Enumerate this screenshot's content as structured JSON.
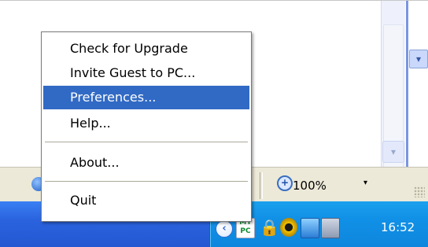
{
  "status_bar": {
    "zoom_label": "100%",
    "zoom_arrow": "▾"
  },
  "context_menu": {
    "items": [
      {
        "label": "Check for Upgrade"
      },
      {
        "label": "Invite Guest to PC..."
      },
      {
        "label": "Preferences...",
        "selected": true
      },
      {
        "label": "Help..."
      },
      {
        "label": "About..."
      },
      {
        "label": "Quit"
      }
    ]
  },
  "taskbar": {
    "tray_icons": [
      "show-hidden-icons-chevron",
      "mypc-icon",
      "lock-icon",
      "security-eye-icon",
      "network-icon",
      "monitor-icon"
    ],
    "mypc_text": "MY PC",
    "clock": "16:52"
  },
  "colors": {
    "menu_highlight": "#316ac5",
    "taskbar": "#2a63de",
    "tray": "#1090e6"
  }
}
